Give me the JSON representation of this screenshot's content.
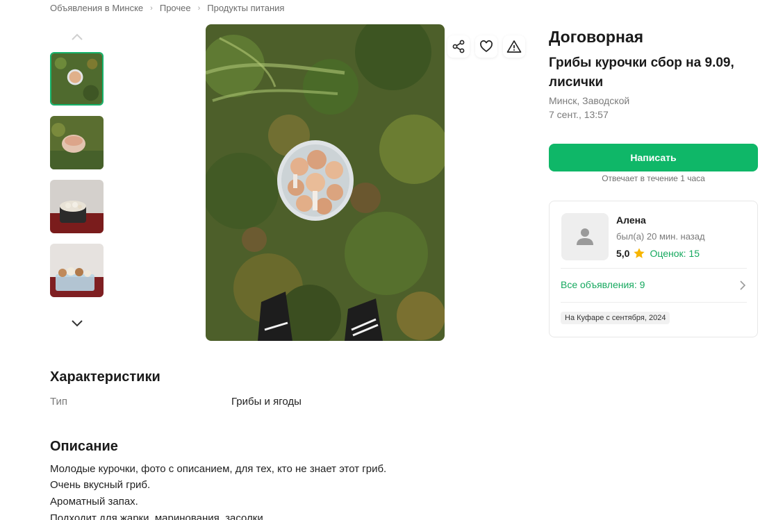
{
  "breadcrumbs": [
    "Объявления в Минске",
    "Прочее",
    "Продукты питания"
  ],
  "listing": {
    "price": "Договорная",
    "title": "Грибы курочки сбор на 9.09, лисички",
    "location": "Минск, Заводской",
    "date": "7 сент., 13:57"
  },
  "actions": {
    "write_label": "Написать",
    "response_time": "Отвечает в течение 1 часа",
    "icons": [
      "share-icon",
      "heart-icon",
      "report-warning-icon"
    ]
  },
  "seller": {
    "name": "Алена",
    "last_seen": "был(а) 20 мин. назад",
    "rating": "5,0",
    "reviews": "Оценок: 15",
    "all_ads": "Все объявления: 9",
    "since": "На Куфаре с сентября, 2024"
  },
  "characteristics": {
    "title": "Характеристики",
    "rows": [
      {
        "label": "Тип",
        "value": "Грибы и ягоды"
      }
    ]
  },
  "description": {
    "title": "Описание",
    "lines": [
      "Молодые курочки, фото с описанием, для тех, кто не знает этот гриб.",
      "Очень вкусный гриб.",
      "Ароматный запах.",
      "Подходит для жарки, маринования, засолки"
    ]
  },
  "colors": {
    "accent": "#0fb768",
    "star": "#f7b500",
    "link": "#15a85e"
  }
}
